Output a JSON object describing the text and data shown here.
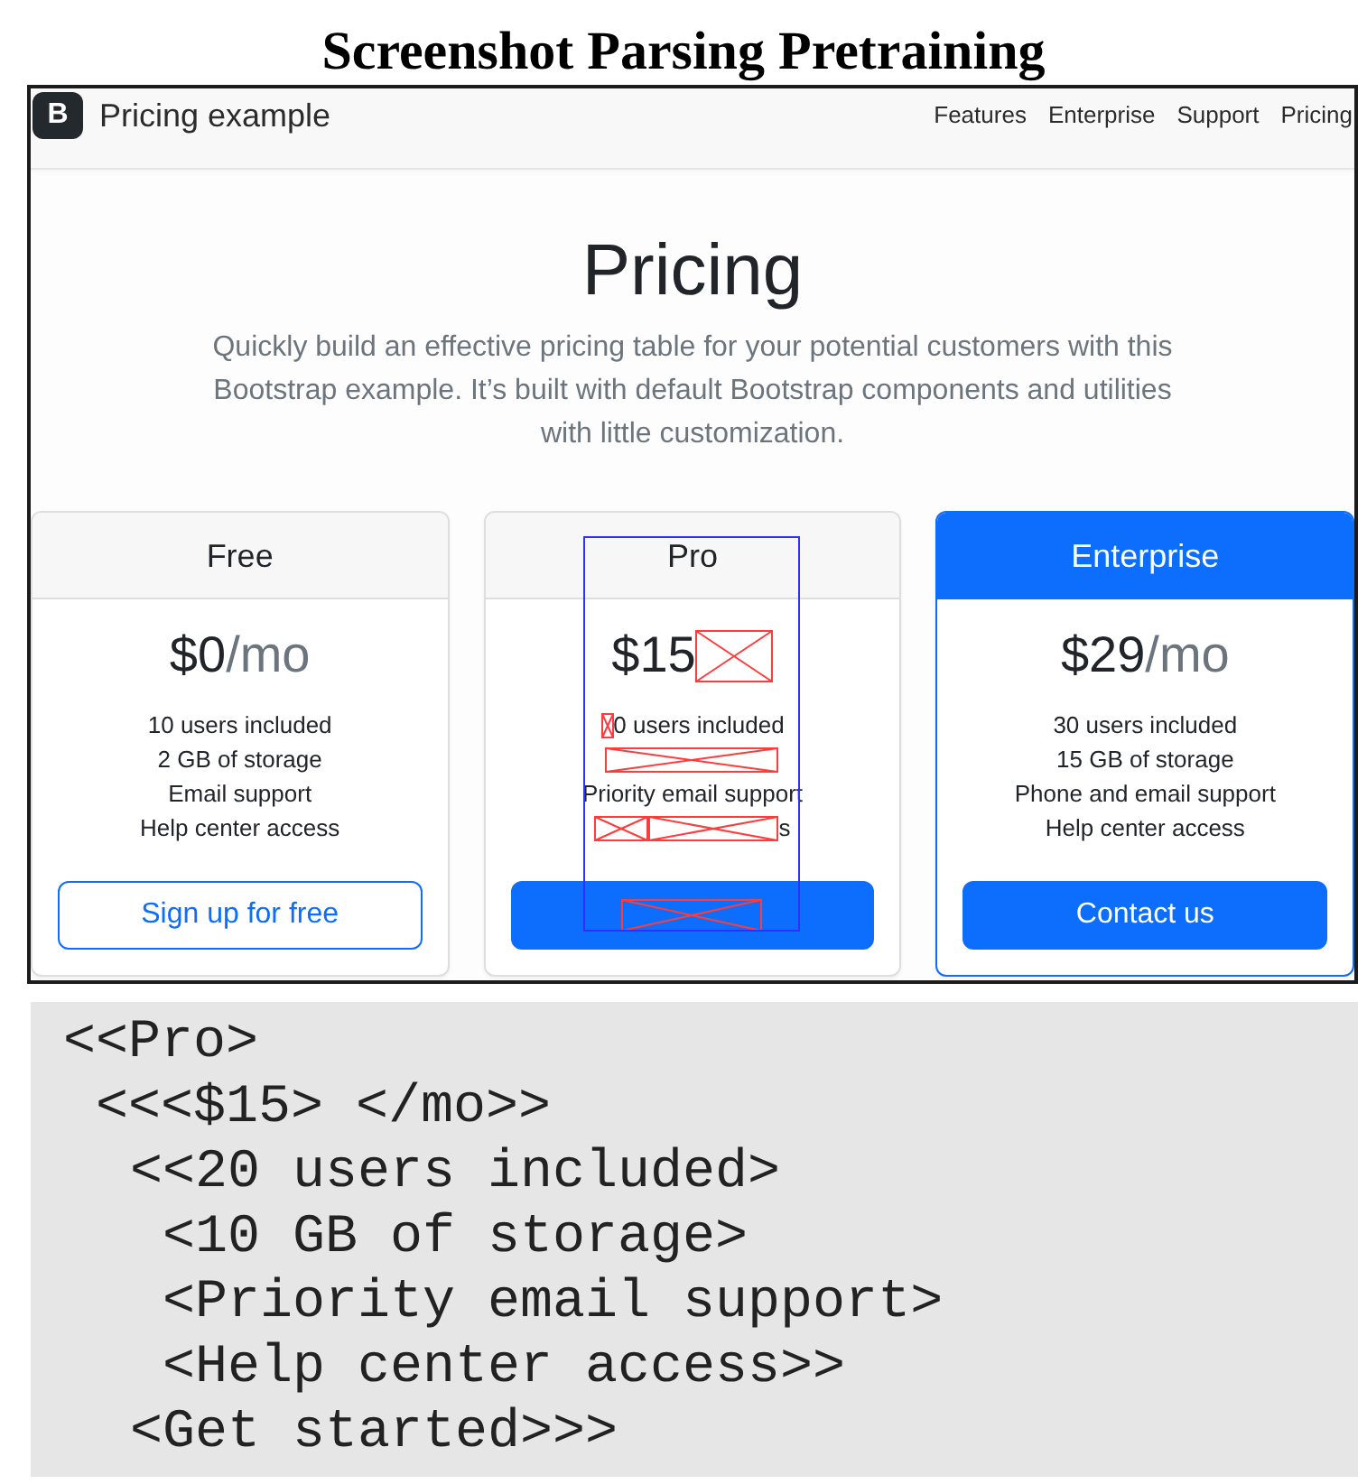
{
  "figure_title": "Screenshot Parsing Pretraining",
  "screenshot": {
    "navbar": {
      "logo": "B",
      "brand": "Pricing example",
      "links": [
        "Features",
        "Enterprise",
        "Support",
        "Pricing"
      ]
    },
    "hero": {
      "heading": "Pricing",
      "lead": "Quickly build an effective pricing table for your potential customers with this Bootstrap example. It’s built with default Bootstrap components and utilities with little customization."
    },
    "cards": [
      {
        "title": "Free",
        "featured": false,
        "highlighted": false,
        "price": {
          "amount": "$0",
          "period": {
            "kind": "text",
            "text": "/mo"
          }
        },
        "features": [
          {
            "parts": [
              {
                "kind": "text",
                "text": "10 users included"
              }
            ]
          },
          {
            "parts": [
              {
                "kind": "text",
                "text": "2 GB of storage"
              }
            ]
          },
          {
            "parts": [
              {
                "kind": "text",
                "text": "Email support"
              }
            ]
          },
          {
            "parts": [
              {
                "kind": "text",
                "text": "Help center access"
              }
            ]
          }
        ],
        "button": {
          "kind": "outline",
          "label": {
            "kind": "text",
            "text": "Sign up for free"
          }
        }
      },
      {
        "title": "Pro",
        "featured": false,
        "highlighted": true,
        "price": {
          "amount": "$15",
          "period": {
            "kind": "mask"
          }
        },
        "features": [
          {
            "parts": [
              {
                "kind": "mask"
              },
              {
                "kind": "text",
                "text": "0 users included"
              }
            ]
          },
          {
            "parts": [
              {
                "kind": "mask"
              }
            ]
          },
          {
            "parts": [
              {
                "kind": "text",
                "text": "Priority email support"
              }
            ]
          },
          {
            "parts": [
              {
                "kind": "mask"
              },
              {
                "kind": "mask"
              },
              {
                "kind": "text",
                "text": "s"
              }
            ]
          }
        ],
        "button": {
          "kind": "filled",
          "label": {
            "kind": "mask"
          }
        }
      },
      {
        "title": "Enterprise",
        "featured": true,
        "highlighted": false,
        "price": {
          "amount": "$29",
          "period": {
            "kind": "text",
            "text": "/mo"
          }
        },
        "features": [
          {
            "parts": [
              {
                "kind": "text",
                "text": "30 users included"
              }
            ]
          },
          {
            "parts": [
              {
                "kind": "text",
                "text": "15 GB of storage"
              }
            ]
          },
          {
            "parts": [
              {
                "kind": "text",
                "text": "Phone and email support"
              }
            ]
          },
          {
            "parts": [
              {
                "kind": "text",
                "text": "Help center access"
              }
            ]
          }
        ],
        "button": {
          "kind": "filled",
          "label": {
            "kind": "text",
            "text": "Contact us"
          }
        }
      }
    ]
  },
  "parse_tree": [
    {
      "text": "<<Pro>",
      "children": [
        {
          "text": "<<<$15> </mo>>",
          "children": [
            {
              "text": "<<20 users included>",
              "children": [
                {
                  "text": "<10 GB of storage>"
                },
                {
                  "text": "<Priority email support>"
                },
                {
                  "text": "<Help center access>>"
                }
              ]
            },
            {
              "text": "<Get started>>>"
            }
          ]
        }
      ]
    }
  ]
}
